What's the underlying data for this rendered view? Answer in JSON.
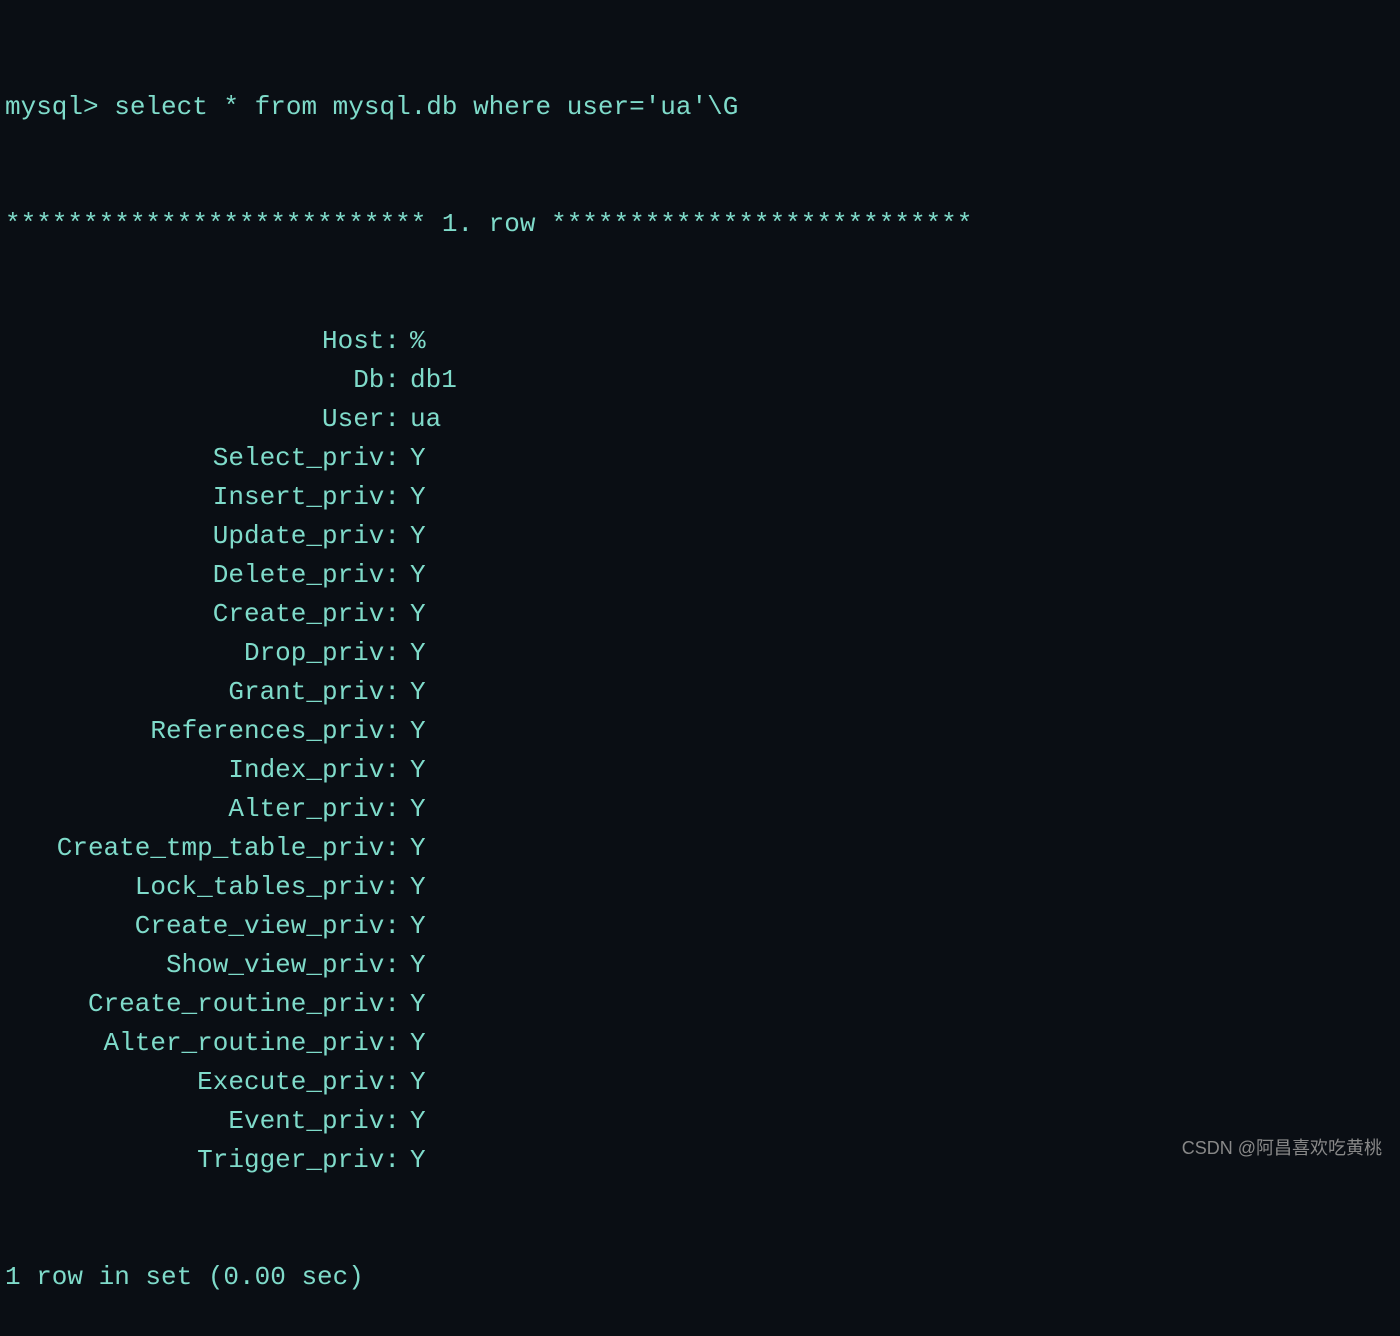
{
  "prompt": "mysql> select * from mysql.db where user='ua'\\G",
  "row_header": "*************************** 1. row ***************************",
  "fields": [
    {
      "label": "Host:",
      "value": "%"
    },
    {
      "label": "Db:",
      "value": "db1"
    },
    {
      "label": "User:",
      "value": "ua"
    },
    {
      "label": "Select_priv:",
      "value": "Y"
    },
    {
      "label": "Insert_priv:",
      "value": "Y"
    },
    {
      "label": "Update_priv:",
      "value": "Y"
    },
    {
      "label": "Delete_priv:",
      "value": "Y"
    },
    {
      "label": "Create_priv:",
      "value": "Y"
    },
    {
      "label": "Drop_priv:",
      "value": "Y"
    },
    {
      "label": "Grant_priv:",
      "value": "Y"
    },
    {
      "label": "References_priv:",
      "value": "Y"
    },
    {
      "label": "Index_priv:",
      "value": "Y"
    },
    {
      "label": "Alter_priv:",
      "value": "Y"
    },
    {
      "label": "Create_tmp_table_priv:",
      "value": "Y"
    },
    {
      "label": "Lock_tables_priv:",
      "value": "Y"
    },
    {
      "label": "Create_view_priv:",
      "value": "Y"
    },
    {
      "label": "Show_view_priv:",
      "value": "Y"
    },
    {
      "label": "Create_routine_priv:",
      "value": "Y"
    },
    {
      "label": "Alter_routine_priv:",
      "value": "Y"
    },
    {
      "label": "Execute_priv:",
      "value": "Y"
    },
    {
      "label": "Event_priv:",
      "value": "Y"
    },
    {
      "label": "Trigger_priv:",
      "value": "Y"
    }
  ],
  "footer": "1 row in set (0.00 sec)",
  "watermark": "CSDN @阿昌喜欢吃黄桃"
}
